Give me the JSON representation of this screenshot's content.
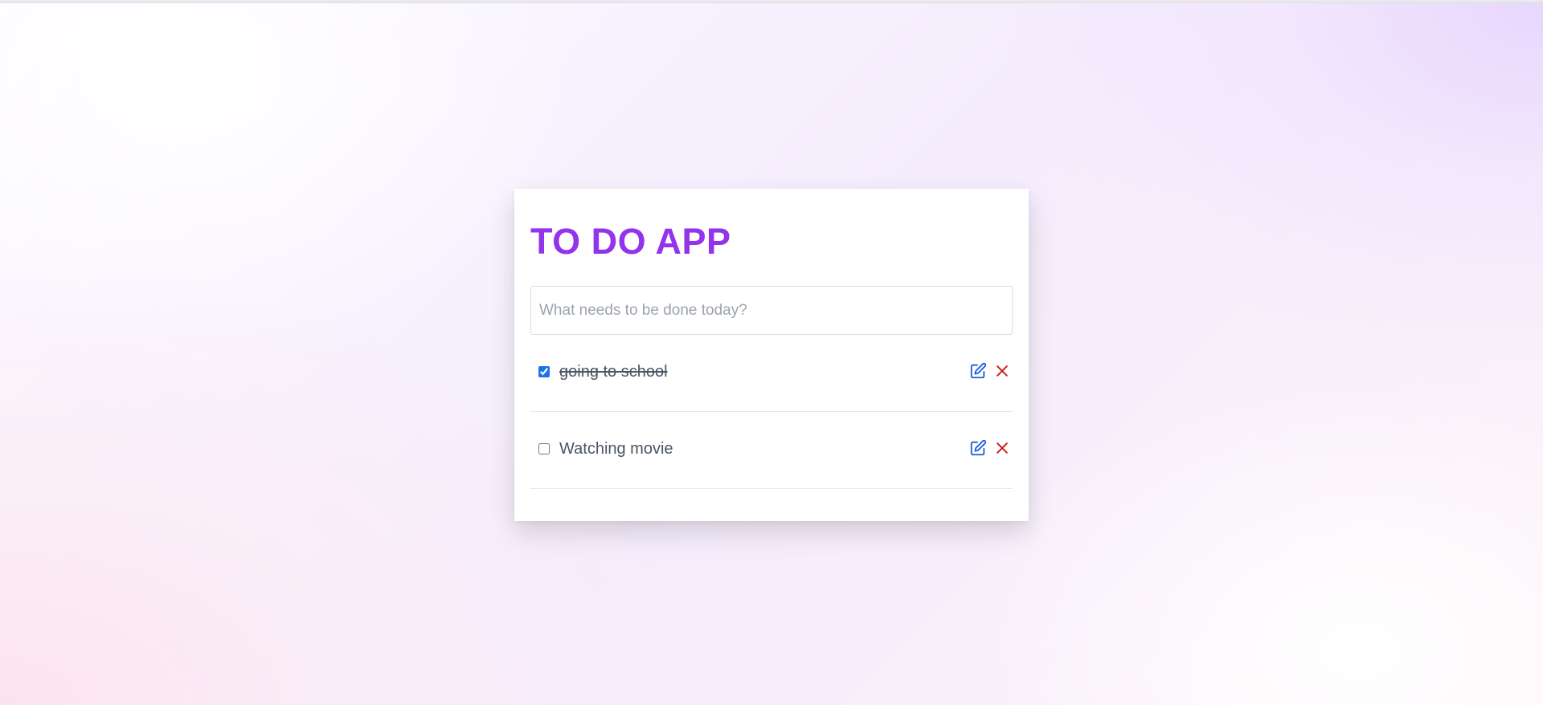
{
  "app": {
    "title": "TO DO APP"
  },
  "new_task": {
    "placeholder": "What needs to be done today?",
    "value": ""
  },
  "todos": [
    {
      "text": "going to school",
      "completed": true
    },
    {
      "text": "Watching movie",
      "completed": false
    }
  ],
  "icons": {
    "edit": "edit-icon",
    "delete": "close-icon"
  },
  "colors": {
    "title": "#9333ea",
    "edit_icon": "#1d5fd6",
    "delete_icon": "#c81e1e",
    "checkbox_accent": "#1a73e8"
  }
}
